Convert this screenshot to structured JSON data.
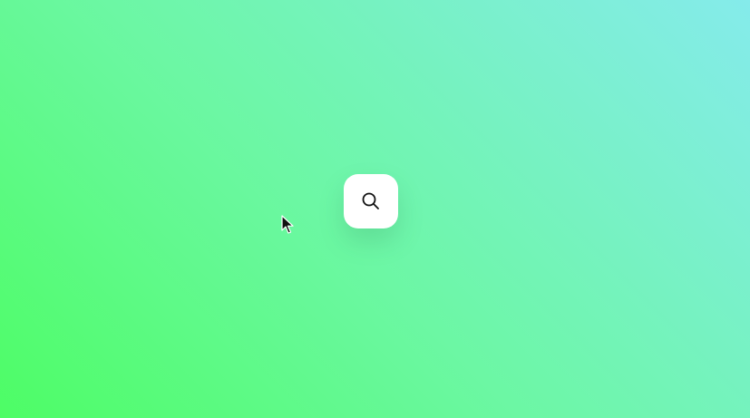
{
  "background": {
    "gradient_start": "#4dfd65",
    "gradient_mid": "#6cf7a4",
    "gradient_end": "#85ebeb"
  },
  "search_button": {
    "icon": "search-icon",
    "background_color": "#ffffff",
    "icon_color": "#111111"
  },
  "cursor": {
    "icon": "mouse-pointer-icon"
  }
}
